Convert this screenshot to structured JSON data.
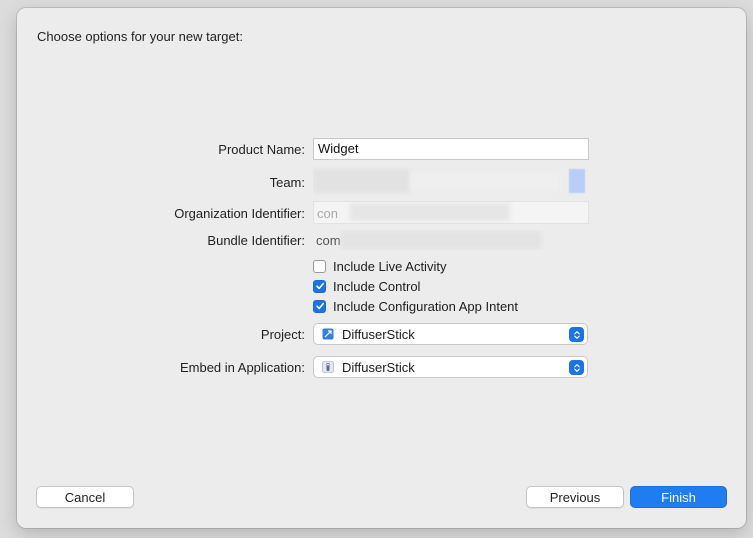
{
  "dialog": {
    "heading": "Choose options for your new target:"
  },
  "form": {
    "product_name": {
      "label": "Product Name:",
      "value": "Widget"
    },
    "team": {
      "label": "Team:"
    },
    "organization_identifier": {
      "label": "Organization Identifier:",
      "value": "con"
    },
    "bundle_identifier": {
      "label": "Bundle Identifier:",
      "value": "com"
    },
    "options": [
      {
        "label": "Include Live Activity",
        "checked": false
      },
      {
        "label": "Include Control",
        "checked": true
      },
      {
        "label": "Include Configuration App Intent",
        "checked": true
      }
    ],
    "project": {
      "label": "Project:",
      "value": "DiffuserStick",
      "icon": "xcode-project-icon"
    },
    "embed_in_application": {
      "label": "Embed in Application:",
      "value": "DiffuserStick",
      "icon": "app-target-icon"
    }
  },
  "buttons": {
    "cancel": "Cancel",
    "previous": "Previous",
    "finish": "Finish"
  },
  "colors": {
    "accent": "#1f7cf1",
    "sheet_background": "#ececec"
  }
}
